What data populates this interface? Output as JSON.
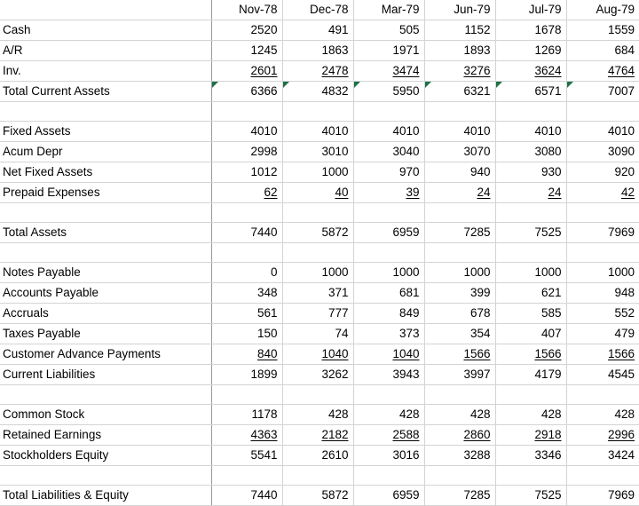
{
  "app": {
    "type": "spreadsheet",
    "title": "Balance Sheet",
    "gridline_color": "#d4d4d4",
    "divider_color": "#9a9a9a",
    "flag_marker_color": "#1e7145",
    "flag_marker_name": "green-corner-triangle"
  },
  "columns": {
    "label_header": "",
    "periods": [
      "Nov-78",
      "Dec-78",
      "Mar-79",
      "Jun-79",
      "Jul-79",
      "Aug-79"
    ]
  },
  "rows": [
    {
      "id": "cash",
      "label": "Cash",
      "values": [
        "2520",
        "491",
        "505",
        "1152",
        "1678",
        "1559"
      ],
      "underline": false,
      "flagged": []
    },
    {
      "id": "ar",
      "label": "A/R",
      "values": [
        "1245",
        "1863",
        "1971",
        "1893",
        "1269",
        "684"
      ],
      "underline": false,
      "flagged": []
    },
    {
      "id": "inv",
      "label": "Inv.",
      "values": [
        "2601",
        "2478",
        "3474",
        "3276",
        "3624",
        "4764"
      ],
      "underline": true,
      "flagged": []
    },
    {
      "id": "total-current-assets",
      "label": "Total Current Assets",
      "values": [
        "6366",
        "4832",
        "5950",
        "6321",
        "6571",
        "7007"
      ],
      "underline": false,
      "flagged": [
        0,
        1,
        2,
        3,
        4,
        5
      ]
    },
    {
      "id": "spacer-1",
      "label": "",
      "values": [
        "",
        "",
        "",
        "",
        "",
        ""
      ],
      "underline": false,
      "flagged": []
    },
    {
      "id": "fixed-assets",
      "label": "Fixed Assets",
      "values": [
        "4010",
        "4010",
        "4010",
        "4010",
        "4010",
        "4010"
      ],
      "underline": false,
      "flagged": []
    },
    {
      "id": "acum-depr",
      "label": "Acum Depr",
      "values": [
        "2998",
        "3010",
        "3040",
        "3070",
        "3080",
        "3090"
      ],
      "underline": false,
      "flagged": []
    },
    {
      "id": "net-fixed-assets",
      "label": "Net Fixed Assets",
      "values": [
        "1012",
        "1000",
        "970",
        "940",
        "930",
        "920"
      ],
      "underline": false,
      "flagged": []
    },
    {
      "id": "prepaid-expenses",
      "label": "Prepaid Expenses",
      "values": [
        "62",
        "40",
        "39",
        "24",
        "24",
        "42"
      ],
      "underline": true,
      "flagged": []
    },
    {
      "id": "spacer-2",
      "label": "",
      "values": [
        "",
        "",
        "",
        "",
        "",
        ""
      ],
      "underline": false,
      "flagged": []
    },
    {
      "id": "total-assets",
      "label": "Total Assets",
      "values": [
        "7440",
        "5872",
        "6959",
        "7285",
        "7525",
        "7969"
      ],
      "underline": false,
      "flagged": []
    },
    {
      "id": "spacer-3",
      "label": "",
      "values": [
        "",
        "",
        "",
        "",
        "",
        ""
      ],
      "underline": false,
      "flagged": []
    },
    {
      "id": "notes-payable",
      "label": "Notes Payable",
      "values": [
        "0",
        "1000",
        "1000",
        "1000",
        "1000",
        "1000"
      ],
      "underline": false,
      "flagged": []
    },
    {
      "id": "accounts-payable",
      "label": "Accounts Payable",
      "values": [
        "348",
        "371",
        "681",
        "399",
        "621",
        "948"
      ],
      "underline": false,
      "flagged": []
    },
    {
      "id": "accruals",
      "label": "Accruals",
      "values": [
        "561",
        "777",
        "849",
        "678",
        "585",
        "552"
      ],
      "underline": false,
      "flagged": []
    },
    {
      "id": "taxes-payable",
      "label": "Taxes Payable",
      "values": [
        "150",
        "74",
        "373",
        "354",
        "407",
        "479"
      ],
      "underline": false,
      "flagged": []
    },
    {
      "id": "customer-advance-payments",
      "label": "Customer Advance Payments",
      "values": [
        "840",
        "1040",
        "1040",
        "1566",
        "1566",
        "1566"
      ],
      "underline": true,
      "flagged": []
    },
    {
      "id": "current-liabilities",
      "label": "Current Liabilities",
      "values": [
        "1899",
        "3262",
        "3943",
        "3997",
        "4179",
        "4545"
      ],
      "underline": false,
      "flagged": []
    },
    {
      "id": "spacer-4",
      "label": "",
      "values": [
        "",
        "",
        "",
        "",
        "",
        ""
      ],
      "underline": false,
      "flagged": []
    },
    {
      "id": "common-stock",
      "label": "Common Stock",
      "values": [
        "1178",
        "428",
        "428",
        "428",
        "428",
        "428"
      ],
      "underline": false,
      "flagged": []
    },
    {
      "id": "retained-earnings",
      "label": "Retained Earnings",
      "values": [
        "4363",
        "2182",
        "2588",
        "2860",
        "2918",
        "2996"
      ],
      "underline": true,
      "flagged": []
    },
    {
      "id": "stockholders-equity",
      "label": "Stockholders Equity",
      "values": [
        "5541",
        "2610",
        "3016",
        "3288",
        "3346",
        "3424"
      ],
      "underline": false,
      "flagged": []
    },
    {
      "id": "spacer-5",
      "label": "",
      "values": [
        "",
        "",
        "",
        "",
        "",
        ""
      ],
      "underline": false,
      "flagged": []
    },
    {
      "id": "total-liabilities-and-equity",
      "label": "Total Liabilities & Equity",
      "values": [
        "7440",
        "5872",
        "6959",
        "7285",
        "7525",
        "7969"
      ],
      "underline": false,
      "flagged": []
    }
  ]
}
